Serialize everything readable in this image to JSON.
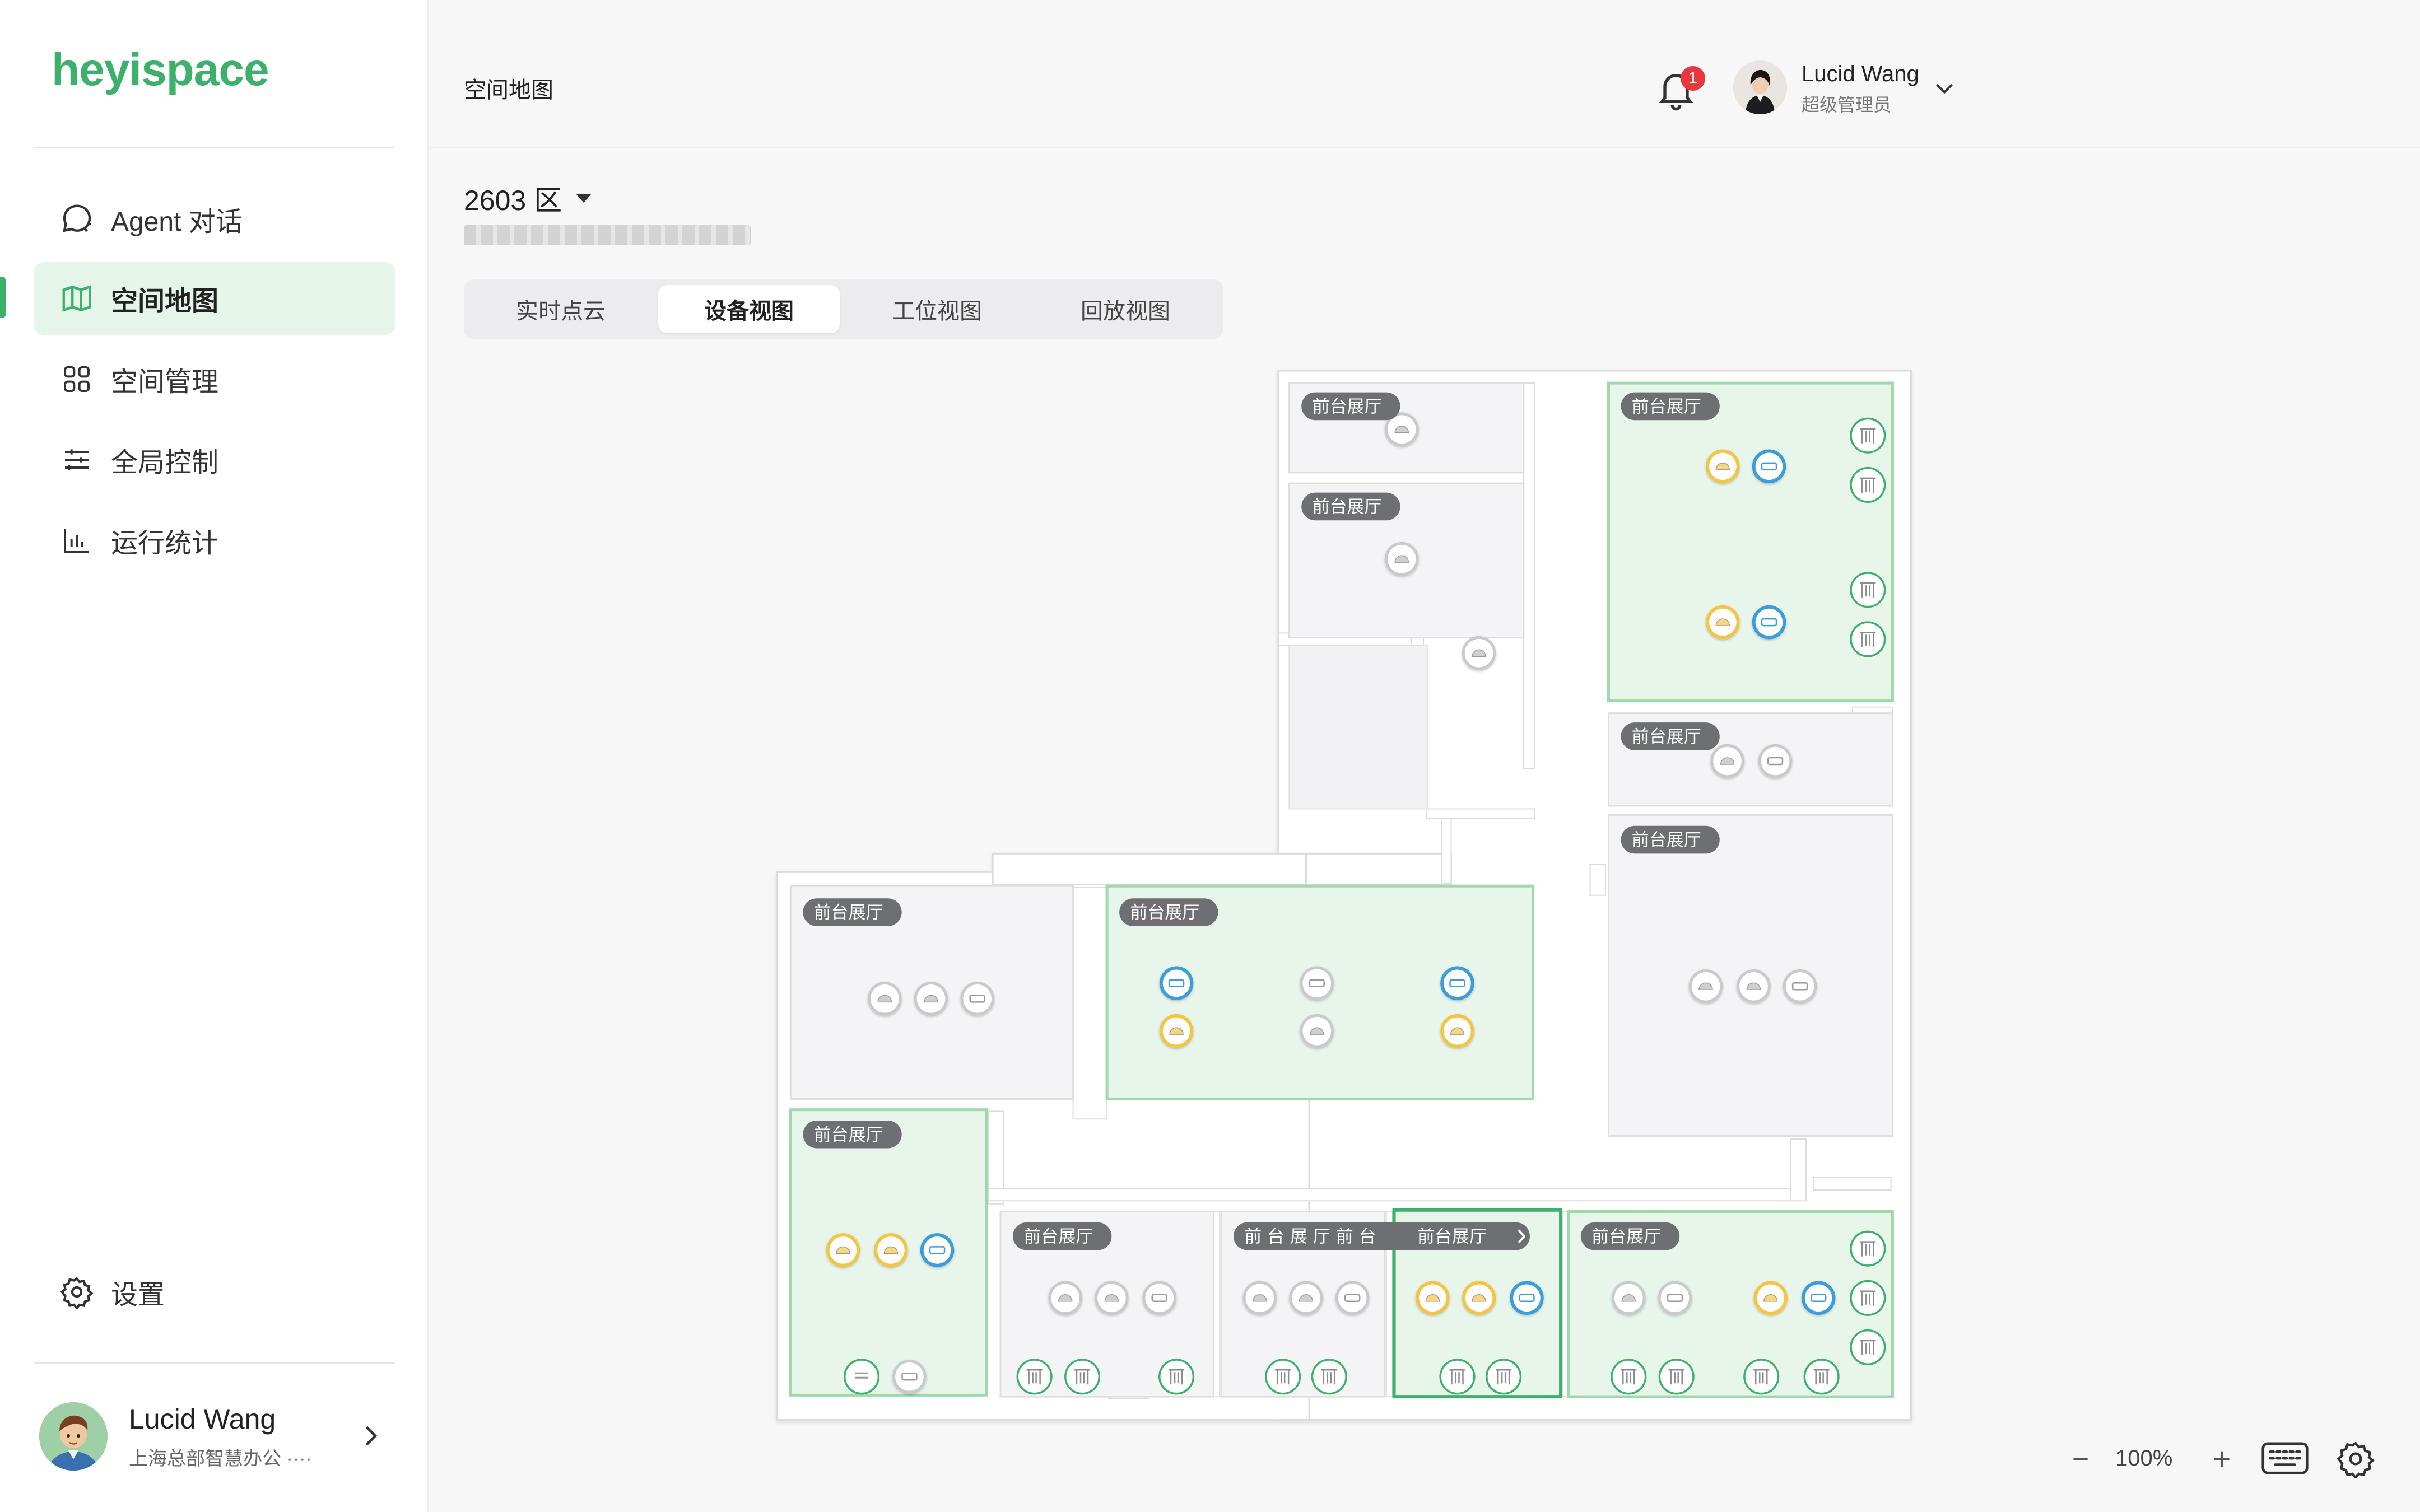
{
  "app": {
    "logo": "heyispace"
  },
  "sidebar": {
    "items": [
      {
        "label": "Agent 对话",
        "icon": "chat-icon"
      },
      {
        "label": "空间地图",
        "icon": "map-icon"
      },
      {
        "label": "空间管理",
        "icon": "grid-icon"
      },
      {
        "label": "全局控制",
        "icon": "sliders-icon"
      },
      {
        "label": "运行统计",
        "icon": "bar-chart-icon"
      }
    ],
    "active_index": 1,
    "settings_label": "设置",
    "user": {
      "name": "Lucid Wang",
      "org": "上海总部智慧办公 ····"
    }
  },
  "header": {
    "title": "空间地图",
    "notification_count": "1",
    "user": {
      "name": "Lucid Wang",
      "role": "超级管理员"
    }
  },
  "zone": {
    "name": "2603 区"
  },
  "tabs": [
    {
      "label": "实时点云"
    },
    {
      "label": "设备视图"
    },
    {
      "label": "工位视图"
    },
    {
      "label": "回放视图"
    }
  ],
  "active_tab": 1,
  "map": {
    "room_labels": {
      "default": "前台展厅",
      "reception": "前 台 展 厅 前 台",
      "selected": "前台展厅"
    }
  },
  "controls": {
    "zoom_level": "100%",
    "zoom_out": "−",
    "zoom_in": "+"
  },
  "colors": {
    "accent": "#3db06b",
    "active_room_fill": "#e7f5ea",
    "active_room_border": "#9fd8ab",
    "device_gray": "#c9cacd",
    "device_yellow": "#f4c542",
    "device_blue": "#3b9ddb",
    "device_green_outline": "#3db06b",
    "badge_red": "#e8383d"
  }
}
